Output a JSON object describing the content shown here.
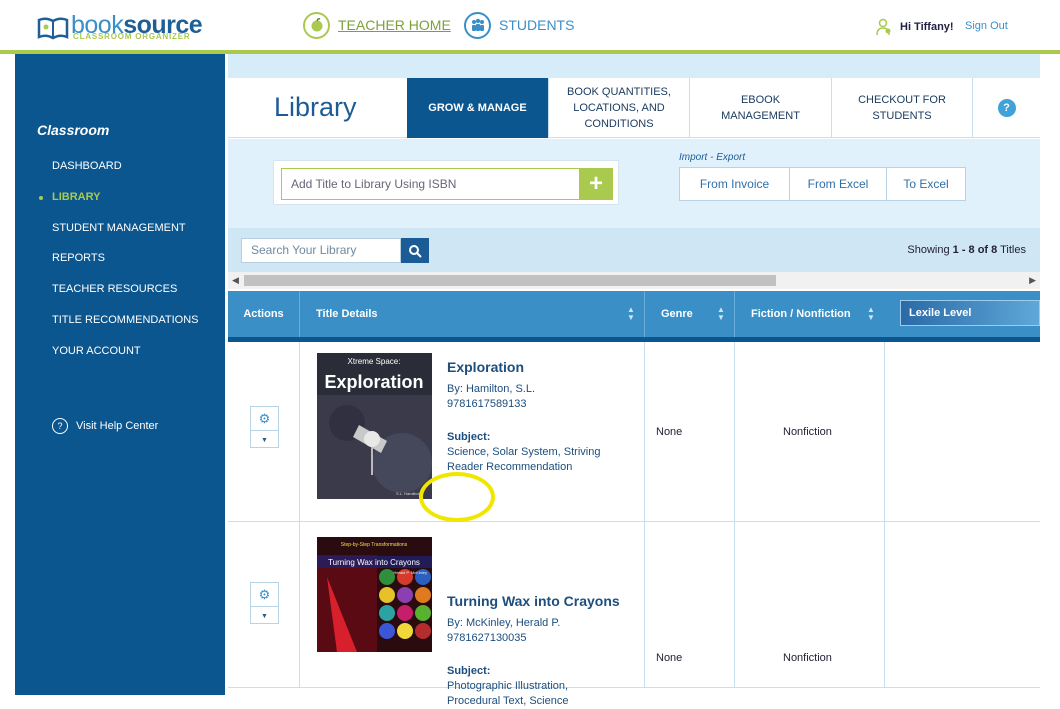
{
  "header": {
    "logo_word_light": "book",
    "logo_word_bold": "source",
    "logo_sub": "CLASSROOM ORGANIZER",
    "nav": [
      {
        "label": "TEACHER HOME",
        "icon": "apple-icon"
      },
      {
        "label": "STUDENTS",
        "icon": "students-icon"
      }
    ],
    "greeting": "Hi Tiffany!",
    "sign_out": "Sign Out",
    "colors": {
      "accent_green": "#a9c94f",
      "brand_blue": "#0b568f"
    }
  },
  "sidebar": {
    "heading": "Classroom",
    "items": [
      {
        "label": "DASHBOARD",
        "active": false
      },
      {
        "label": "LIBRARY",
        "active": true
      },
      {
        "label": "STUDENT MANAGEMENT",
        "active": false
      },
      {
        "label": "REPORTS",
        "active": false
      },
      {
        "label": "TEACHER RESOURCES",
        "active": false
      },
      {
        "label": "TITLE RECOMMENDATIONS",
        "active": false
      },
      {
        "label": "YOUR ACCOUNT",
        "active": false
      }
    ],
    "help_label": "Visit Help Center"
  },
  "library": {
    "title": "Library",
    "tabs": [
      {
        "label": "GROW & MANAGE",
        "active": true
      },
      {
        "label": "BOOK QUANTITIES, LOCATIONS, AND CONDITIONS",
        "active": false
      },
      {
        "label": "eBOOK MANAGEMENT",
        "active": false
      },
      {
        "label": "CHECKOUT FOR STUDENTS",
        "active": false
      }
    ],
    "help_icon": "?"
  },
  "tools": {
    "isbn_placeholder": "Add Title to Library Using ISBN",
    "add_symbol": "+",
    "import_export_label": "Import - Export",
    "import_export_buttons": [
      "From Invoice",
      "From Excel",
      "To Excel"
    ]
  },
  "search": {
    "placeholder": "Search Your Library",
    "showing_prefix": "Showing ",
    "showing_range": "1 - 8 of 8",
    "showing_suffix": " Titles"
  },
  "table": {
    "columns": [
      "Actions",
      "Title Details",
      "Genre",
      "Fiction / Nonfiction",
      "Lexile Level"
    ],
    "rows": [
      {
        "cover_series": "Xtreme Space:",
        "cover_title": "Exploration",
        "cover_author": "S.L. Hamilton",
        "title": "Exploration",
        "author": "By: Hamilton, S.L.",
        "isbn": "9781617589133",
        "subject_label": "Subject:",
        "subjects_line1": "Science, Solar System, Striving",
        "subjects_line2": "Reader Recommendation",
        "genre": "None",
        "fiction": "Nonfiction",
        "badge_icon": "lightning-bolt-icon"
      },
      {
        "cover_series": "Step-by-Step Transformations",
        "cover_title": "Turning Wax into Crayons",
        "cover_author": "Herald P. McKinley",
        "title": "Turning Wax into Crayons",
        "author": "By: McKinley, Herald P.",
        "isbn": "9781627130035",
        "subject_label": "Subject:",
        "subjects_line1": "Photographic Illustration,",
        "subjects_line2": "Procedural Text, Science",
        "genre": "None",
        "fiction": "Nonfiction"
      }
    ]
  }
}
